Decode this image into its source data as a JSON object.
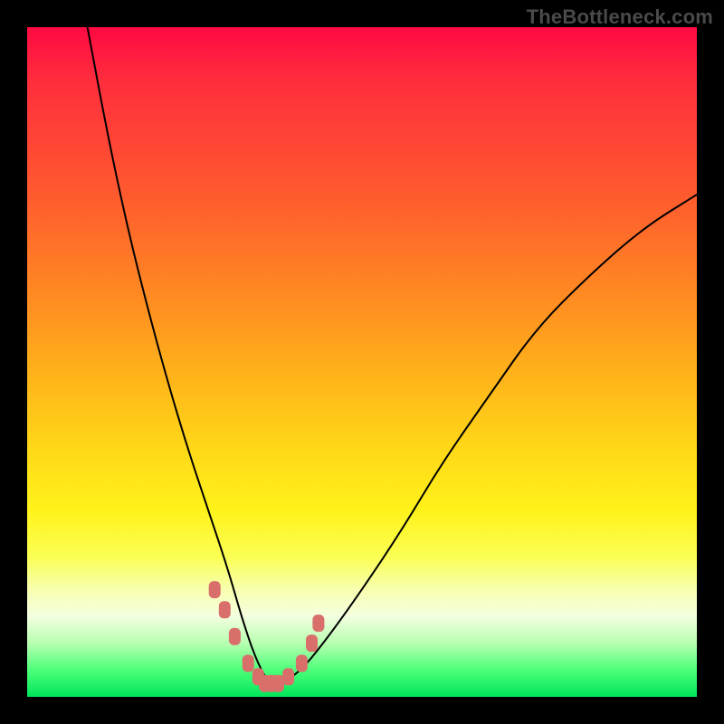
{
  "watermark": "TheBottleneck.com",
  "colors": {
    "background": "#000000",
    "marker": "#d96f6b",
    "curve": "#000000"
  },
  "chart_data": {
    "type": "line",
    "title": "",
    "xlabel": "",
    "ylabel": "",
    "xlim": [
      0,
      100
    ],
    "ylim": [
      0,
      100
    ],
    "note": "No axes, ticks, or labels are rendered in the source image. x/y are estimated normalized coordinates (0–100, y-up). Curve is a V-shape dipping to near y=0 around x≈36.",
    "curve": {
      "x": [
        9,
        12,
        15,
        18,
        21,
        24,
        27,
        30,
        32,
        34,
        36,
        38,
        41,
        45,
        50,
        56,
        62,
        69,
        76,
        84,
        92,
        100
      ],
      "y": [
        100,
        84,
        70,
        58,
        47,
        37,
        28,
        19,
        12,
        6,
        2,
        2,
        4,
        9,
        16,
        25,
        35,
        45,
        55,
        63,
        70,
        75
      ]
    },
    "markers": {
      "description": "Short thick marks near the curve minimum, roughly symmetric across the valley, color #d96f6b",
      "x": [
        28,
        29.5,
        31,
        33,
        34.5,
        35.5,
        36.5,
        37.5,
        39,
        41,
        42.5,
        43.5
      ],
      "y": [
        16,
        13,
        9,
        5,
        3,
        2,
        2,
        2,
        3,
        5,
        8,
        11
      ]
    }
  }
}
